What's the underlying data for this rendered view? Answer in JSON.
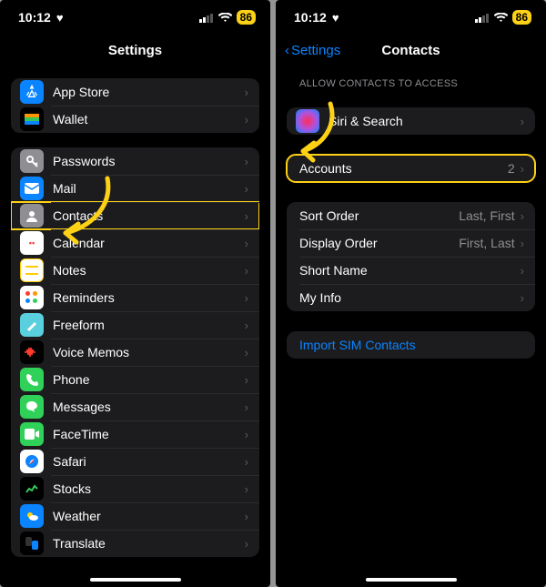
{
  "status": {
    "time": "10:12",
    "battery": "86"
  },
  "left": {
    "title": "Settings",
    "group1": [
      {
        "label": "App Store",
        "icon": "appstore"
      },
      {
        "label": "Wallet",
        "icon": "wallet"
      }
    ],
    "group2": [
      {
        "label": "Passwords",
        "icon": "passwords"
      },
      {
        "label": "Mail",
        "icon": "mail"
      },
      {
        "label": "Contacts",
        "icon": "contacts",
        "hi": true
      },
      {
        "label": "Calendar",
        "icon": "calendar"
      },
      {
        "label": "Notes",
        "icon": "notes"
      },
      {
        "label": "Reminders",
        "icon": "reminders"
      },
      {
        "label": "Freeform",
        "icon": "freeform"
      },
      {
        "label": "Voice Memos",
        "icon": "voicememos"
      },
      {
        "label": "Phone",
        "icon": "phone"
      },
      {
        "label": "Messages",
        "icon": "messages"
      },
      {
        "label": "FaceTime",
        "icon": "facetime"
      },
      {
        "label": "Safari",
        "icon": "safari"
      },
      {
        "label": "Stocks",
        "icon": "stocks"
      },
      {
        "label": "Weather",
        "icon": "weather"
      },
      {
        "label": "Translate",
        "icon": "translate"
      }
    ]
  },
  "right": {
    "back": "Settings",
    "title": "Contacts",
    "section_header": "Allow Contacts to Access",
    "siri": {
      "label": "Siri & Search"
    },
    "accounts": {
      "label": "Accounts",
      "value": "2"
    },
    "settings": [
      {
        "label": "Sort Order",
        "value": "Last, First"
      },
      {
        "label": "Display Order",
        "value": "First, Last"
      },
      {
        "label": "Short Name",
        "value": ""
      },
      {
        "label": "My Info",
        "value": ""
      }
    ],
    "import": "Import SIM Contacts"
  }
}
